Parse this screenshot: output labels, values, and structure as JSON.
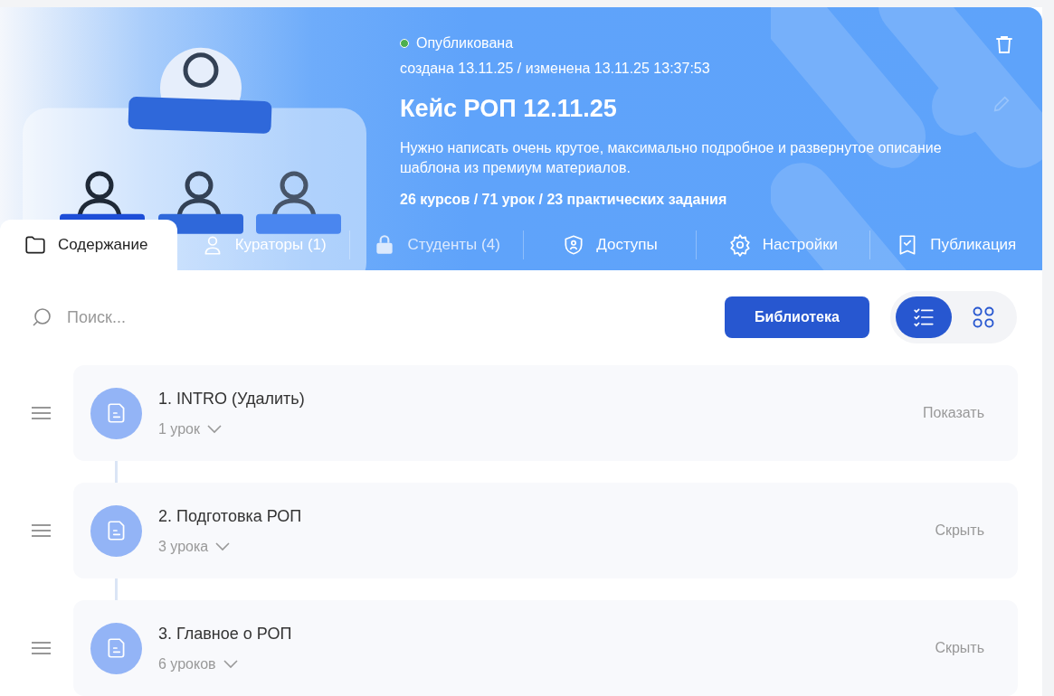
{
  "header": {
    "status": {
      "label": "Опубликована",
      "color": "#4caf50"
    },
    "dates": "создана 13.11.25 / изменена 13.11.25 13:37:53",
    "title": "Кейс РОП 12.11.25",
    "description": "Нужно написать очень крутое, максимально подробное и развернутое описание шаблона из премиум материалов.",
    "stats": "26 курсов / 71 урок / 23 практических задания"
  },
  "tabs": [
    {
      "kind": "folder",
      "label": "Содержание",
      "selected": true,
      "disabled": false
    },
    {
      "kind": "user",
      "label": "Кураторы (1)",
      "selected": false,
      "disabled": false
    },
    {
      "kind": "lock",
      "label": "Студенты (4)",
      "selected": false,
      "disabled": true
    },
    {
      "kind": "shield",
      "label": "Доступы",
      "selected": false,
      "disabled": false
    },
    {
      "kind": "gear",
      "label": "Настройки",
      "selected": false,
      "disabled": false
    },
    {
      "kind": "check",
      "label": "Публикация",
      "selected": false,
      "disabled": false
    }
  ],
  "search": {
    "placeholder": "Поиск..."
  },
  "library_button": "Библиотека",
  "view_toggle": [
    {
      "kind": "list",
      "selected": true
    },
    {
      "kind": "grid",
      "selected": false
    }
  ],
  "modules": [
    {
      "title": "1. INTRO (Удалить)",
      "count": "1 урок",
      "action": "Показать"
    },
    {
      "title": "2. Подготовка РОП",
      "count": "3 урока",
      "action": "Скрыть"
    },
    {
      "title": "3. Главное о РОП",
      "count": "6 уроков",
      "action": "Скрыть"
    }
  ]
}
